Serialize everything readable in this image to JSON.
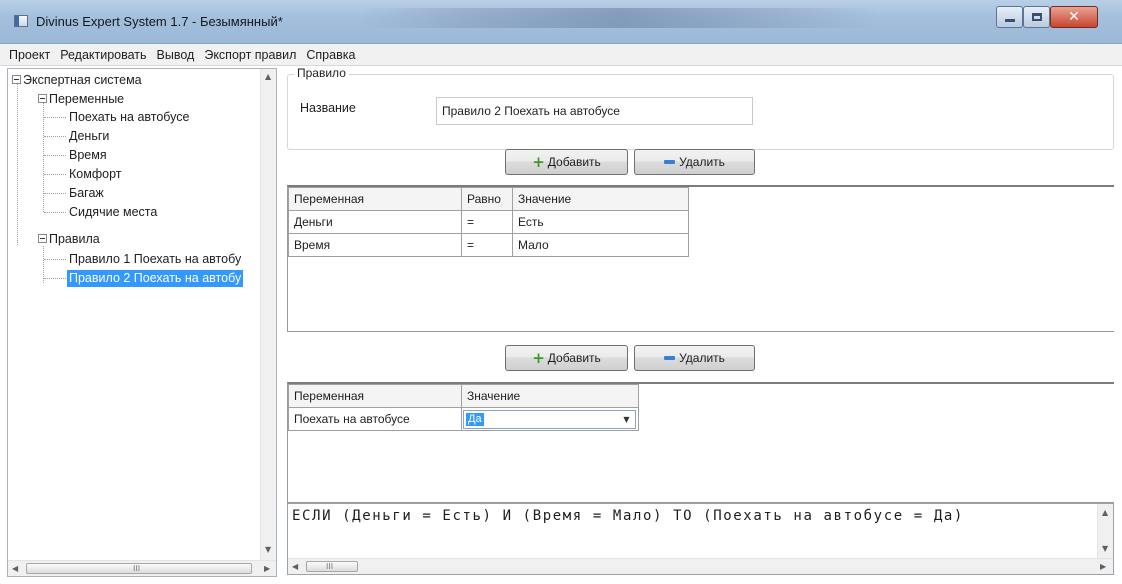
{
  "window": {
    "title": "Divinus Expert System 1.7 - Безымянный*"
  },
  "menu": {
    "items": [
      "Проект",
      "Редактировать",
      "Вывод",
      "Экспорт правил",
      "Справка"
    ]
  },
  "tree": {
    "root": "Экспертная система",
    "variables_group": "Переменные",
    "variables": [
      "Поехать на автобусе",
      "Деньги",
      "Время",
      "Комфорт",
      "Багаж",
      "Сидячие места"
    ],
    "rules_group": "Правила",
    "rules": [
      "Правило 1 Поехать на автобу",
      "Правило 2 Поехать на автобу"
    ],
    "selected_index": 1
  },
  "rule": {
    "groupbox_title": "Правило",
    "name_label": "Название",
    "name_value": "Правило 2 Поехать на автобусе"
  },
  "conditions": {
    "add_label": "Добавить",
    "delete_label": "Удалить",
    "headers": [
      "Переменная",
      "Равно",
      "Значение"
    ],
    "rows": [
      [
        "Деньги",
        "=",
        "Есть"
      ],
      [
        "Время",
        "=",
        "Мало"
      ]
    ]
  },
  "conclusions": {
    "add_label": "Добавить",
    "delete_label": "Удалить",
    "headers": [
      "Переменная",
      "Значение"
    ],
    "row_variable": "Поехать на автобусе",
    "row_value": "Да"
  },
  "rule_text": "ЕСЛИ (Деньги = Есть) И (Время = Мало) ТО (Поехать на автобусе = Да)",
  "scroll_grip": "III"
}
